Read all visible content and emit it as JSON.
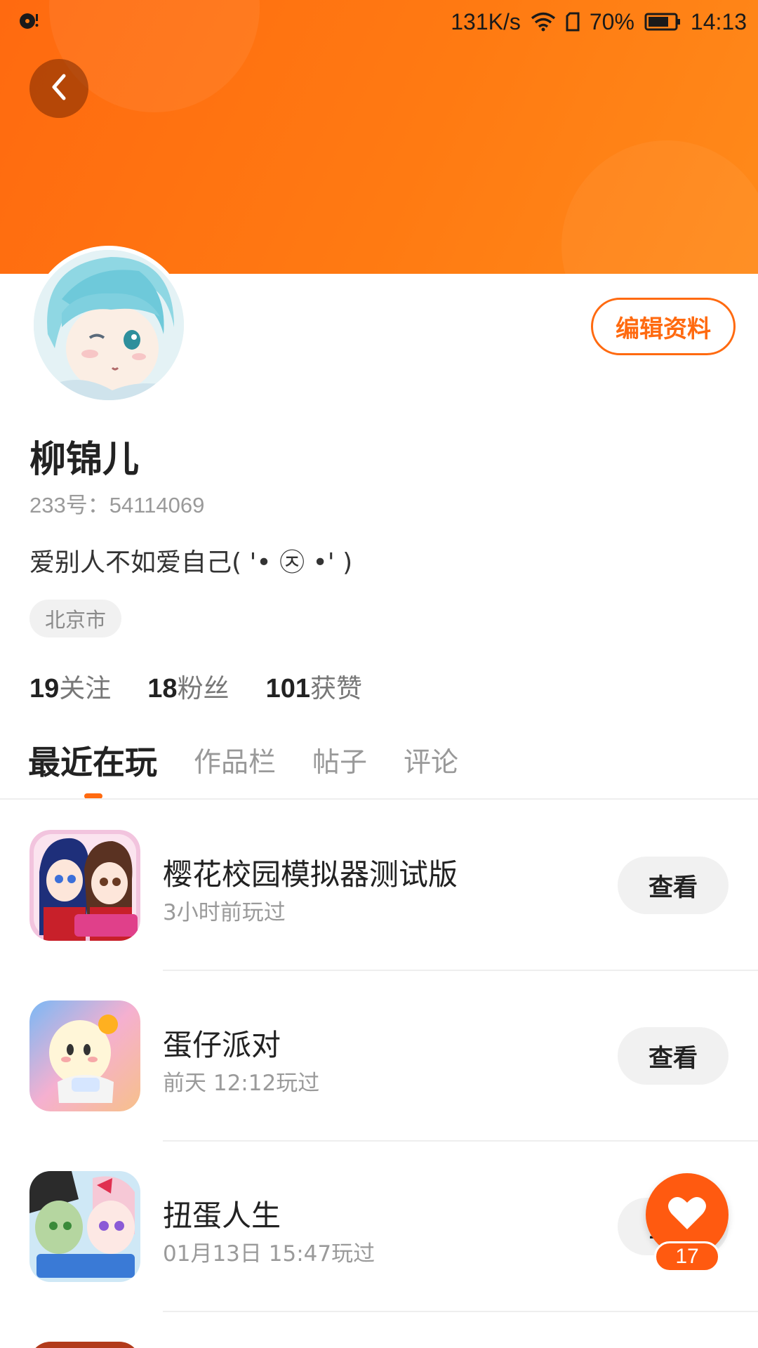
{
  "status_bar": {
    "speed": "131K/s",
    "battery": "70%",
    "time": "14:13"
  },
  "profile": {
    "name": "柳锦儿",
    "uid": "233号：54114069",
    "bio": "爱别人不如爱自己( '• ㉨ •' )",
    "location": "北京市",
    "edit_label": "编辑资料",
    "stats": [
      {
        "num": "19",
        "label": "关注"
      },
      {
        "num": "18",
        "label": "粉丝"
      },
      {
        "num": "101",
        "label": "获赞"
      }
    ]
  },
  "tabs": [
    {
      "label": "最近在玩",
      "active": true
    },
    {
      "label": "作品栏",
      "active": false
    },
    {
      "label": "帖子",
      "active": false
    },
    {
      "label": "评论",
      "active": false
    }
  ],
  "games": [
    {
      "title": "樱花校园模拟器测试版",
      "time": "3小时前玩过",
      "action": "查看",
      "badge": "测试版"
    },
    {
      "title": "蛋仔派对",
      "time": "前天 12:12玩过",
      "action": "查看"
    },
    {
      "title": "扭蛋人生",
      "time": "01月13日 15:47玩过",
      "action": "查看",
      "logo": "Gacha Life"
    }
  ],
  "fab": {
    "count": "17"
  },
  "colors": {
    "accent": "#ff6a10",
    "banner": "#ff7a12"
  }
}
